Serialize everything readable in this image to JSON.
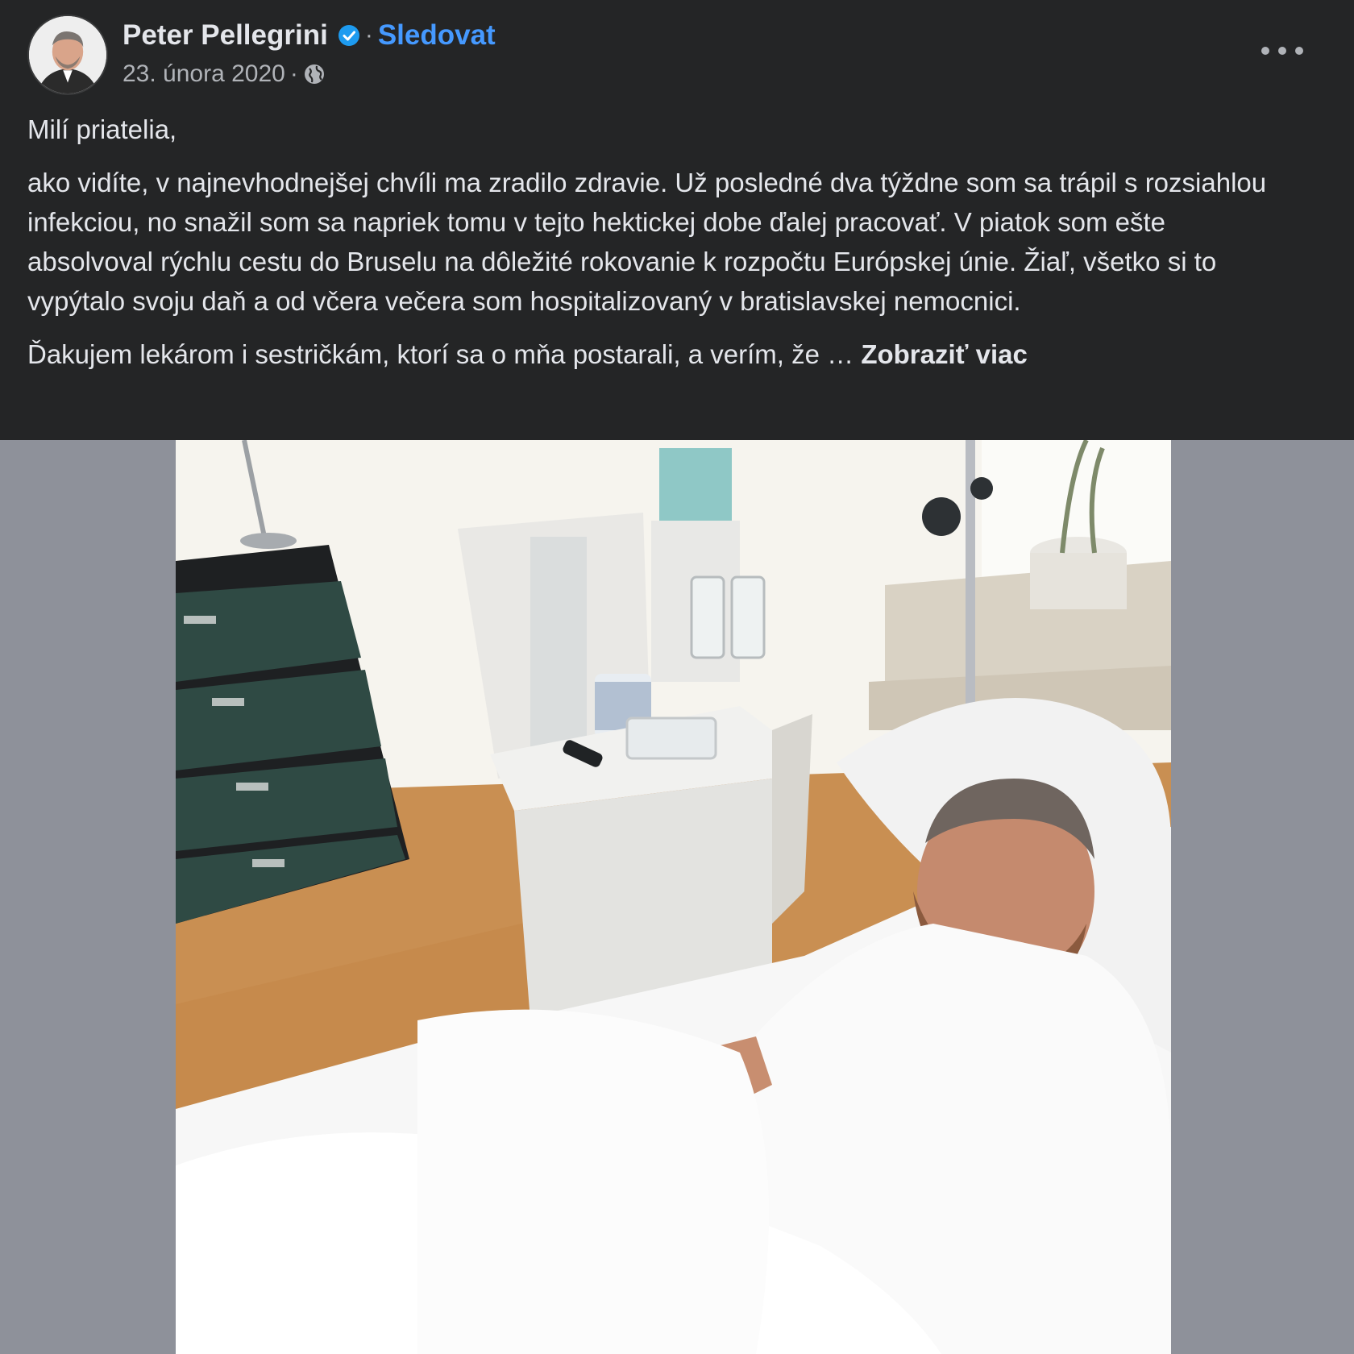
{
  "post": {
    "author": "Peter Pellegrini",
    "separator": "·",
    "follow_label": "Sledovat",
    "date": "23. února 2020",
    "date_separator": "·",
    "paragraphs": [
      "Milí priatelia,",
      "ako vidíte, v najnevhodnejšej chvíli ma zradilo zdravie. Už posledné dva týždne som sa trápil s rozsiahlou infekciou, no snažil som sa napriek tomu v tejto hektickej dobe ďalej pracovať. V piatok som ešte absolvoval rýchlu cestu do Bruselu na dôležité rokovanie k rozpočtu Európskej únie. Žiaľ, všetko si to vypýtalo svoju daň a od včera večera som hospitalizovaný v bratislavskej nemocnici.",
      "Ďakujem lekárom i sestričkám, ktorí sa o mňa postarali, a verím, že … "
    ],
    "see_more_label": "Zobraziť viac"
  },
  "icons": {
    "verified": "verified-badge-icon",
    "audience": "globe-icon",
    "more": "more-options-icon"
  },
  "colors": {
    "background": "#242526",
    "text": "#e4e6eb",
    "secondary_text": "#b0b3b8",
    "link_blue": "#4599ff",
    "verified_blue": "#1d9bf0",
    "photo_letterbox": "#8e919a"
  }
}
